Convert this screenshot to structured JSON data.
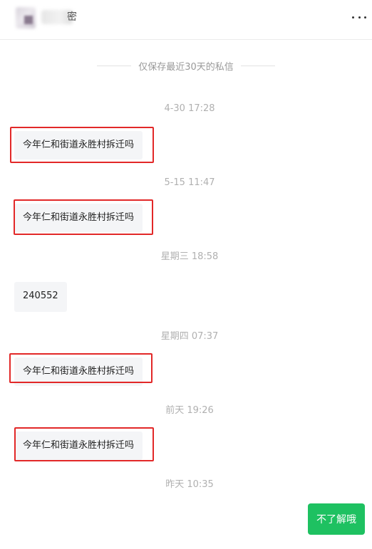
{
  "header": {
    "name_visible_tail": "密",
    "more_icon": "more-horizontal-icon"
  },
  "notice": "仅保存最近30天的私信",
  "messages": [
    {
      "time": "4-30 17:28",
      "text": "今年仁和街道永胜村拆迁吗",
      "highlighted": true
    },
    {
      "time": "5-15 11:47",
      "text": "今年仁和街道永胜村拆迁吗",
      "highlighted": true
    },
    {
      "time": "星期三 18:58",
      "text": "240552",
      "highlighted": false
    },
    {
      "time": "星期四 07:37",
      "text": "今年仁和街道永胜村拆迁吗",
      "highlighted": true
    },
    {
      "time": "前天 19:26",
      "text": "今年仁和街道永胜村拆迁吗",
      "highlighted": true
    }
  ],
  "last_time": "昨天 10:35",
  "reply": "不了解哦",
  "colors": {
    "highlight": "#e22828",
    "reply_bubble": "#1ec161",
    "incoming_bubble": "#f4f5f7"
  }
}
